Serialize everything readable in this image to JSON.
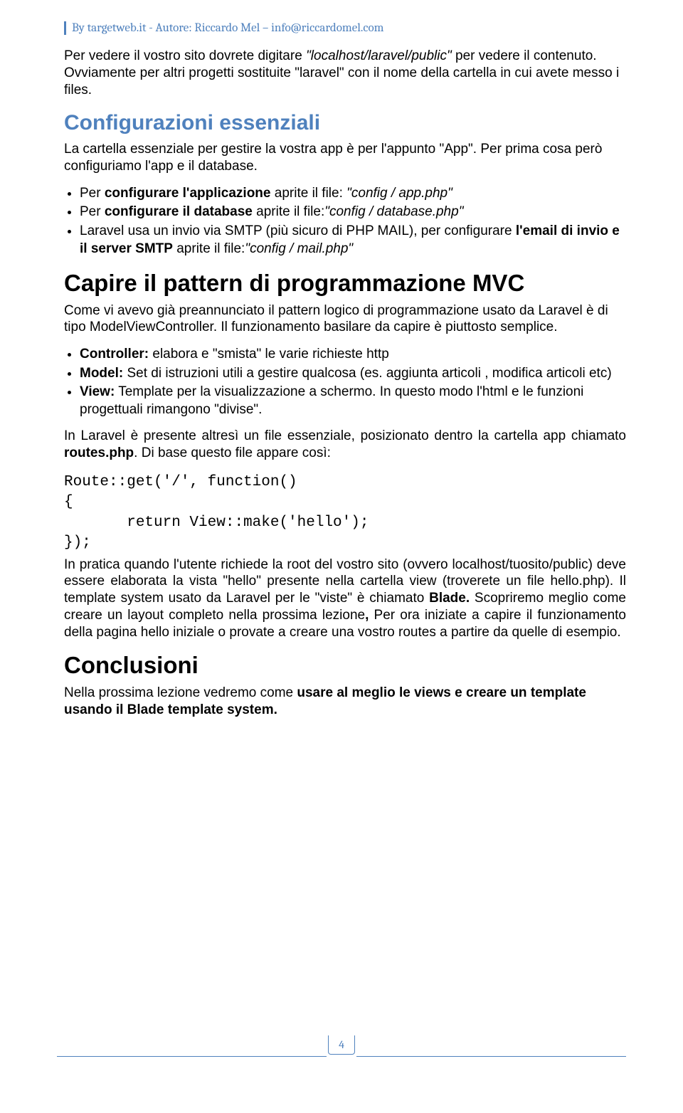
{
  "header": {
    "line": "By targetweb.it  -  Autore: Riccardo Mel – info@riccardomel.com"
  },
  "intro": {
    "p1a": "Per vedere il vostro sito dovrete digitare ",
    "p1b": "\"localhost/laravel/public\"",
    "p1c": " per vedere il contenuto. Ovviamente per altri progetti sostituite \"laravel\" con il nome della cartella in cui avete messo i files."
  },
  "sec1": {
    "title": "Configurazioni essenziali",
    "p1": "La cartella essenziale per gestire la vostra app è per l'appunto \"App\". Per prima cosa però configuriamo l'app e il database.",
    "bullets": [
      {
        "a": "Per ",
        "b": "configurare l'applicazione",
        "c": " aprite il file: ",
        "d": "\"config / app.php\""
      },
      {
        "a": "Per ",
        "b": "configurare il database",
        "c": " aprite il file:",
        "d": "\"config / database.php\""
      },
      {
        "a": "Laravel usa un invio via SMTP (più sicuro di PHP MAIL), per configurare ",
        "b": "l'email di invio e il server SMTP",
        "c": " aprite il file:",
        "d": "\"config / mail.php\""
      }
    ]
  },
  "sec2": {
    "title": "Capire il pattern di programmazione MVC",
    "p1": "Come vi avevo già preannunciato il pattern logico di programmazione usato da Laravel è di tipo ModelViewController. Il funzionamento basilare da capire è piuttosto semplice.",
    "bullets": [
      {
        "b": "Controller:",
        "t": " elabora e \"smista\" le varie richieste http"
      },
      {
        "b": "Model:",
        "t": " Set di istruzioni utili a gestire qualcosa (es. aggiunta articoli , modifica articoli etc)"
      },
      {
        "b": "View:",
        "t": " Template per la visualizzazione a schermo. In questo modo l'html e le funzioni progettuali rimangono \"divise\"."
      }
    ],
    "p2a": "In Laravel è presente altresì un file essenziale, posizionato dentro la cartella app chiamato ",
    "p2b": "routes.php",
    "p2c": ". Di base questo file appare così:",
    "code": "Route::get('/', function()\n{\n       return View::make('hello');\n});",
    "p3a": "In pratica quando l'utente richiede la root del vostro sito (ovvero localhost/tuosito/public) deve essere elaborata la vista \"hello\" presente nella cartella view (troverete un file hello.php). Il template system usato da Laravel per le \"viste\" è chiamato ",
    "p3b": "Blade. ",
    "p3c": "Scopriremo meglio come creare un layout completo nella prossima lezione",
    "p3d": ", ",
    "p3e": "Per ora iniziate a capire il funzionamento della pagina hello iniziale o provate a creare una vostro routes a partire da quelle di esempio."
  },
  "sec3": {
    "title": "Conclusioni",
    "p1a": "Nella prossima lezione vedremo come ",
    "p1b": "usare al meglio le views e creare un template usando il Blade template system."
  },
  "page_number": "4"
}
